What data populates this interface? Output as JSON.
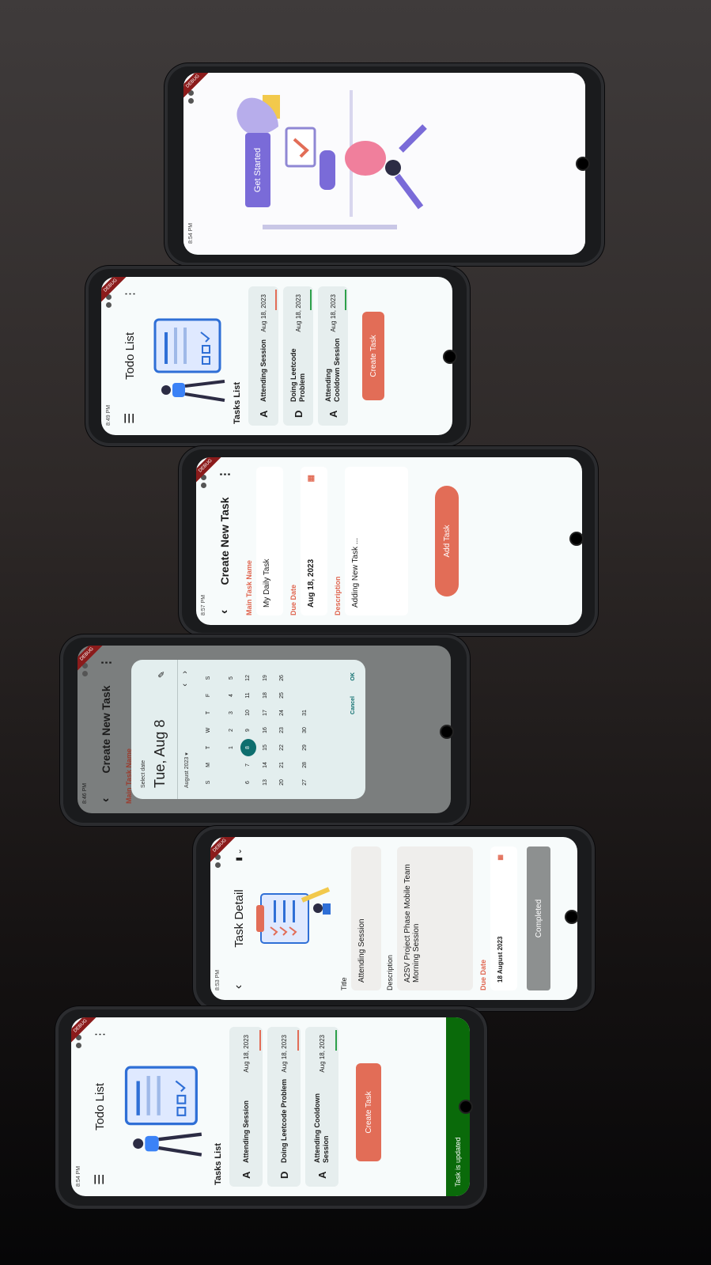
{
  "colors": {
    "accent": "#e26d57",
    "primary": "#7a6bd8",
    "teal": "#0e6e6e",
    "success": "#0a6a0a",
    "grey": "#8d9090"
  },
  "screen1": {
    "status_time": "8:54 PM",
    "get_started": "Get Started"
  },
  "screen2": {
    "status_time": "8:49 PM",
    "title": "Todo List",
    "section": "Tasks List",
    "tasks": [
      {
        "initial": "A",
        "name": "Attending Session",
        "date": "Aug 18, 2023",
        "color": "#e26d57"
      },
      {
        "initial": "D",
        "name": "Doing Leetcode Problem",
        "date": "Aug 18, 2023",
        "color": "#2da04a"
      },
      {
        "initial": "A",
        "name": "Attending Cooldown Session",
        "date": "Aug 18, 2023",
        "color": "#2da04a"
      }
    ],
    "create": "Create Task"
  },
  "screen3": {
    "status_time": "8:57 PM",
    "title": "Create New Task",
    "name_label": "Main Task Name",
    "name_value": "My Daily Task",
    "date_label": "Due Date",
    "date_value": "Aug 18, 2023",
    "desc_label": "Description",
    "desc_value": "Adding New Task ...",
    "add": "Add Task"
  },
  "screen4": {
    "status_time": "8:46 PM",
    "title": "Create New Task",
    "name_label": "Main Task Name",
    "picker": {
      "helper": "Select date",
      "headline": "Tue, Aug 8",
      "month": "August 2023",
      "weekdays": [
        "S",
        "M",
        "T",
        "W",
        "T",
        "F",
        "S"
      ],
      "days": [
        [
          "",
          "",
          "1",
          "2",
          "3",
          "4",
          "5"
        ],
        [
          "6",
          "7",
          "8",
          "9",
          "10",
          "11",
          "12"
        ],
        [
          "13",
          "14",
          "15",
          "16",
          "17",
          "18",
          "19"
        ],
        [
          "20",
          "21",
          "22",
          "23",
          "24",
          "25",
          "26"
        ],
        [
          "27",
          "28",
          "29",
          "30",
          "31",
          "",
          ""
        ]
      ],
      "selected": "8",
      "cancel": "Cancel",
      "ok": "OK"
    }
  },
  "screen5": {
    "status_time": "8:53 PM",
    "title": "Task Detail",
    "title_label": "Title",
    "title_value": "Attending Session",
    "desc_label": "Description",
    "desc_value": "A2SV Project Phase Mobile Team Morning Session",
    "due_label": "Due Date",
    "due_value": "18 August 2023",
    "completed": "Completed"
  },
  "screen6": {
    "status_time": "8:54 PM",
    "title": "Todo List",
    "section": "Tasks List",
    "tasks": [
      {
        "initial": "A",
        "name": "Attending Session",
        "date": "Aug 18, 2023",
        "color": "#e26d57"
      },
      {
        "initial": "D",
        "name": "Doing Leetcode Problem",
        "date": "Aug 18, 2023",
        "color": "#e26d57"
      },
      {
        "initial": "A",
        "name": "Attending Cooldown Session",
        "date": "Aug 18, 2023",
        "color": "#2da04a"
      }
    ],
    "create": "Create Task",
    "snackbar": "Task is updated"
  },
  "debug_banner": "DEBUG"
}
